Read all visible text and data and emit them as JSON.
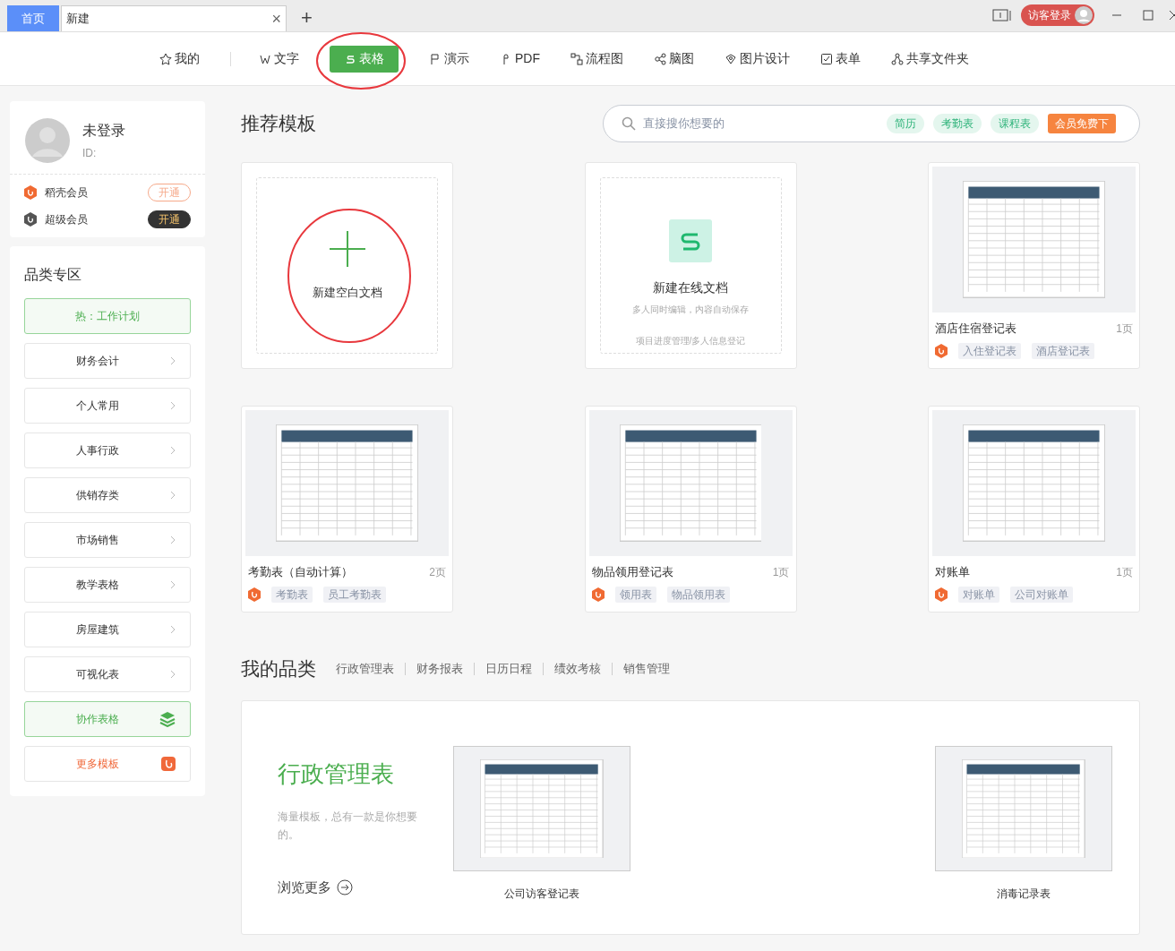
{
  "tabs": [
    {
      "label": "首页",
      "selected": false,
      "kind": "home"
    },
    {
      "label": "新建",
      "selected": true,
      "kind": "doc",
      "close": "×"
    }
  ],
  "new_tab": "+",
  "login_button": "访客登录",
  "nav": [
    {
      "label": "我的",
      "selected": false,
      "circled": false
    },
    {
      "label": "文字",
      "selected": false,
      "circled": false
    },
    {
      "label": "表格",
      "selected": true,
      "circled": true
    },
    {
      "label": "演示",
      "selected": false,
      "circled": false
    },
    {
      "label": "PDF",
      "selected": false,
      "circled": false
    },
    {
      "label": "流程图",
      "selected": false,
      "circled": false
    },
    {
      "label": "脑图",
      "selected": false,
      "circled": false
    },
    {
      "label": "图片设计",
      "selected": false,
      "circled": false
    },
    {
      "label": "表单",
      "selected": false,
      "circled": false
    },
    {
      "label": "共享文件夹",
      "selected": false,
      "circled": false
    }
  ],
  "profile": {
    "name": "未登录",
    "id_label": "ID:",
    "memberships": [
      {
        "name": "稻壳会员",
        "action": "开通",
        "kind": "docer"
      },
      {
        "name": "超级会员",
        "action": "开通",
        "kind": "super"
      }
    ]
  },
  "categories": {
    "title": "品类专区",
    "items": [
      {
        "label": "热：工作计划",
        "kind": "hot"
      },
      {
        "label": "财务会计",
        "kind": "normal"
      },
      {
        "label": "个人常用",
        "kind": "normal"
      },
      {
        "label": "人事行政",
        "kind": "normal"
      },
      {
        "label": "供销存类",
        "kind": "normal"
      },
      {
        "label": "市场销售",
        "kind": "normal"
      },
      {
        "label": "教学表格",
        "kind": "normal"
      },
      {
        "label": "房屋建筑",
        "kind": "normal"
      },
      {
        "label": "可视化表",
        "kind": "normal"
      },
      {
        "label": "协作表格",
        "kind": "collab"
      },
      {
        "label": "更多模板",
        "kind": "more"
      }
    ]
  },
  "recommended": {
    "title": "推荐模板",
    "search": {
      "placeholder": "直接搜你想要的",
      "tags": [
        "简历",
        "考勤表",
        "课程表"
      ],
      "vip_button": "会员免费下"
    },
    "cards": [
      {
        "kind": "blank",
        "title": "新建空白文档",
        "circled": true
      },
      {
        "kind": "online",
        "title": "新建在线文档",
        "subtitle": "多人同时编辑，内容自动保存",
        "hint": "项目进度管理/多人信息登记"
      },
      {
        "kind": "template",
        "title": "酒店住宿登记表",
        "pages": "1页",
        "tags": [
          "入住登记表",
          "酒店登记表"
        ]
      },
      {
        "kind": "template",
        "title": "考勤表（自动计算）",
        "pages": "2页",
        "tags": [
          "考勤表",
          "员工考勤表"
        ]
      },
      {
        "kind": "template",
        "title": "物品领用登记表",
        "pages": "1页",
        "tags": [
          "领用表",
          "物品领用表"
        ]
      },
      {
        "kind": "template",
        "title": "对账单",
        "pages": "1页",
        "tags": [
          "对账单",
          "公司对账单"
        ]
      }
    ]
  },
  "my_categories": {
    "title": "我的品类",
    "tabs": [
      {
        "label": "行政管理表",
        "selected": false
      },
      {
        "label": "财务报表",
        "selected": false
      },
      {
        "label": "日历日程",
        "selected": false
      },
      {
        "label": "绩效考核",
        "selected": false
      },
      {
        "label": "销售管理",
        "selected": false
      }
    ],
    "panel": {
      "heading": "行政管理表",
      "description": "海量模板，总有一款是你想要的。",
      "more": "浏览更多",
      "templates": [
        "公司访客登记表",
        "消毒记录表"
      ]
    }
  }
}
